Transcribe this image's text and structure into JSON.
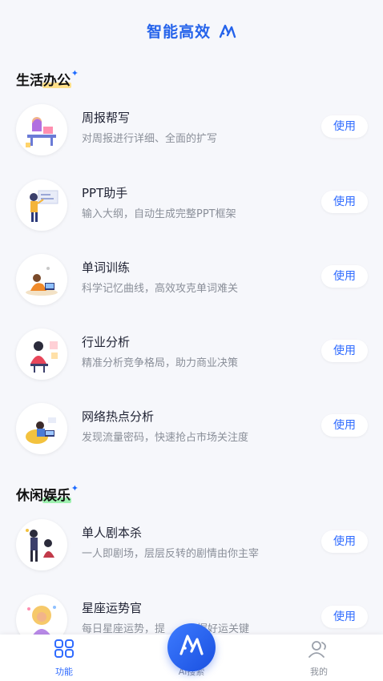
{
  "header": {
    "title": "智能高效",
    "logo_icon": "ai-logo-icon"
  },
  "sections": [
    {
      "title_plain": "生活",
      "title_highlight": "办公",
      "highlight_color": "#ffe08a"
    },
    {
      "title_plain": "休闲",
      "title_highlight": "娱乐",
      "highlight_color": "#9ef0b0"
    }
  ],
  "items": [
    {
      "title": "周报帮写",
      "desc": "对周报进行详细、全面的扩写",
      "button": "使用",
      "icon": "weekly-report-illustration"
    },
    {
      "title": "PPT助手",
      "desc": "输入大纲，自动生成完整PPT框架",
      "button": "使用",
      "icon": "ppt-assistant-illustration"
    },
    {
      "title": "单词训练",
      "desc": "科学记忆曲线，高效攻克单词难关",
      "button": "使用",
      "icon": "word-training-illustration"
    },
    {
      "title": "行业分析",
      "desc": "精准分析竞争格局，助力商业决策",
      "button": "使用",
      "icon": "industry-analysis-illustration"
    },
    {
      "title": "网络热点分析",
      "desc": "发现流量密码，快速抢占市场关注度",
      "button": "使用",
      "icon": "hot-topic-illustration"
    },
    {
      "title": "单人剧本杀",
      "desc": "一人即剧场，层层反转的剧情由你主宰",
      "button": "使用",
      "icon": "murder-mystery-illustration"
    },
    {
      "title": "星座运势官",
      "desc": "每日星座运势，提",
      "desc_tail": "握好运关键",
      "button": "使用",
      "icon": "horoscope-illustration"
    }
  ],
  "tabbar": {
    "tabs": [
      {
        "label": "功能",
        "icon": "grid-icon",
        "active": true
      },
      {
        "label": "Ai搜索",
        "icon": "ai-search-icon",
        "active": false
      },
      {
        "label": "我的",
        "icon": "user-icon",
        "active": false
      }
    ],
    "fab_text": "Ai",
    "accent": "#2f6bff"
  }
}
